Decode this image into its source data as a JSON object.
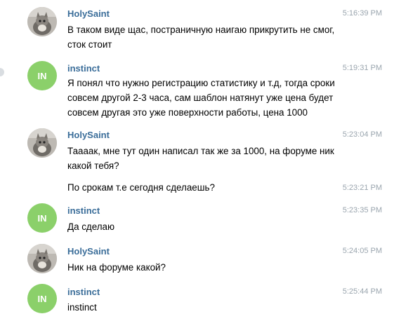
{
  "messages": [
    {
      "author": "HolySaint",
      "time": "5:16:39 PM",
      "avatar": "cat-photo",
      "text": "В таком виде щас, постраничную наигаю прикрутить не смог, сток стоит"
    },
    {
      "author": "instinct",
      "time": "5:19:31 PM",
      "avatar_initials": "IN",
      "text": "Я понял что нужно регистрацию статистику и т.д, тогда сроки совсем другой 2-3 часа, сам шаблон натянут уже цена будет совсем другая это уже поверхности работы, цена 1000"
    },
    {
      "author": "HolySaint",
      "time": "5:23:04 PM",
      "avatar": "cat-photo",
      "text": "Таааак, мне тут один написал так же за 1000, на форуме ник какой тебя?"
    },
    {
      "time": "5:23:21 PM",
      "text": "По срокам т.е сегодня сделаешь?"
    },
    {
      "author": "instinct",
      "time": "5:23:35 PM",
      "avatar_initials": "IN",
      "text": "Да сделаю"
    },
    {
      "author": "HolySaint",
      "time": "5:24:05 PM",
      "avatar": "cat-photo",
      "text": "Ник на форуме какой?"
    },
    {
      "author": "instinct",
      "time": "5:25:44 PM",
      "avatar_initials": "IN",
      "text": "instinct"
    }
  ],
  "colors": {
    "author": "#3a6d99",
    "avatar_in": "#8bd06a",
    "time": "#9aa5ae"
  }
}
